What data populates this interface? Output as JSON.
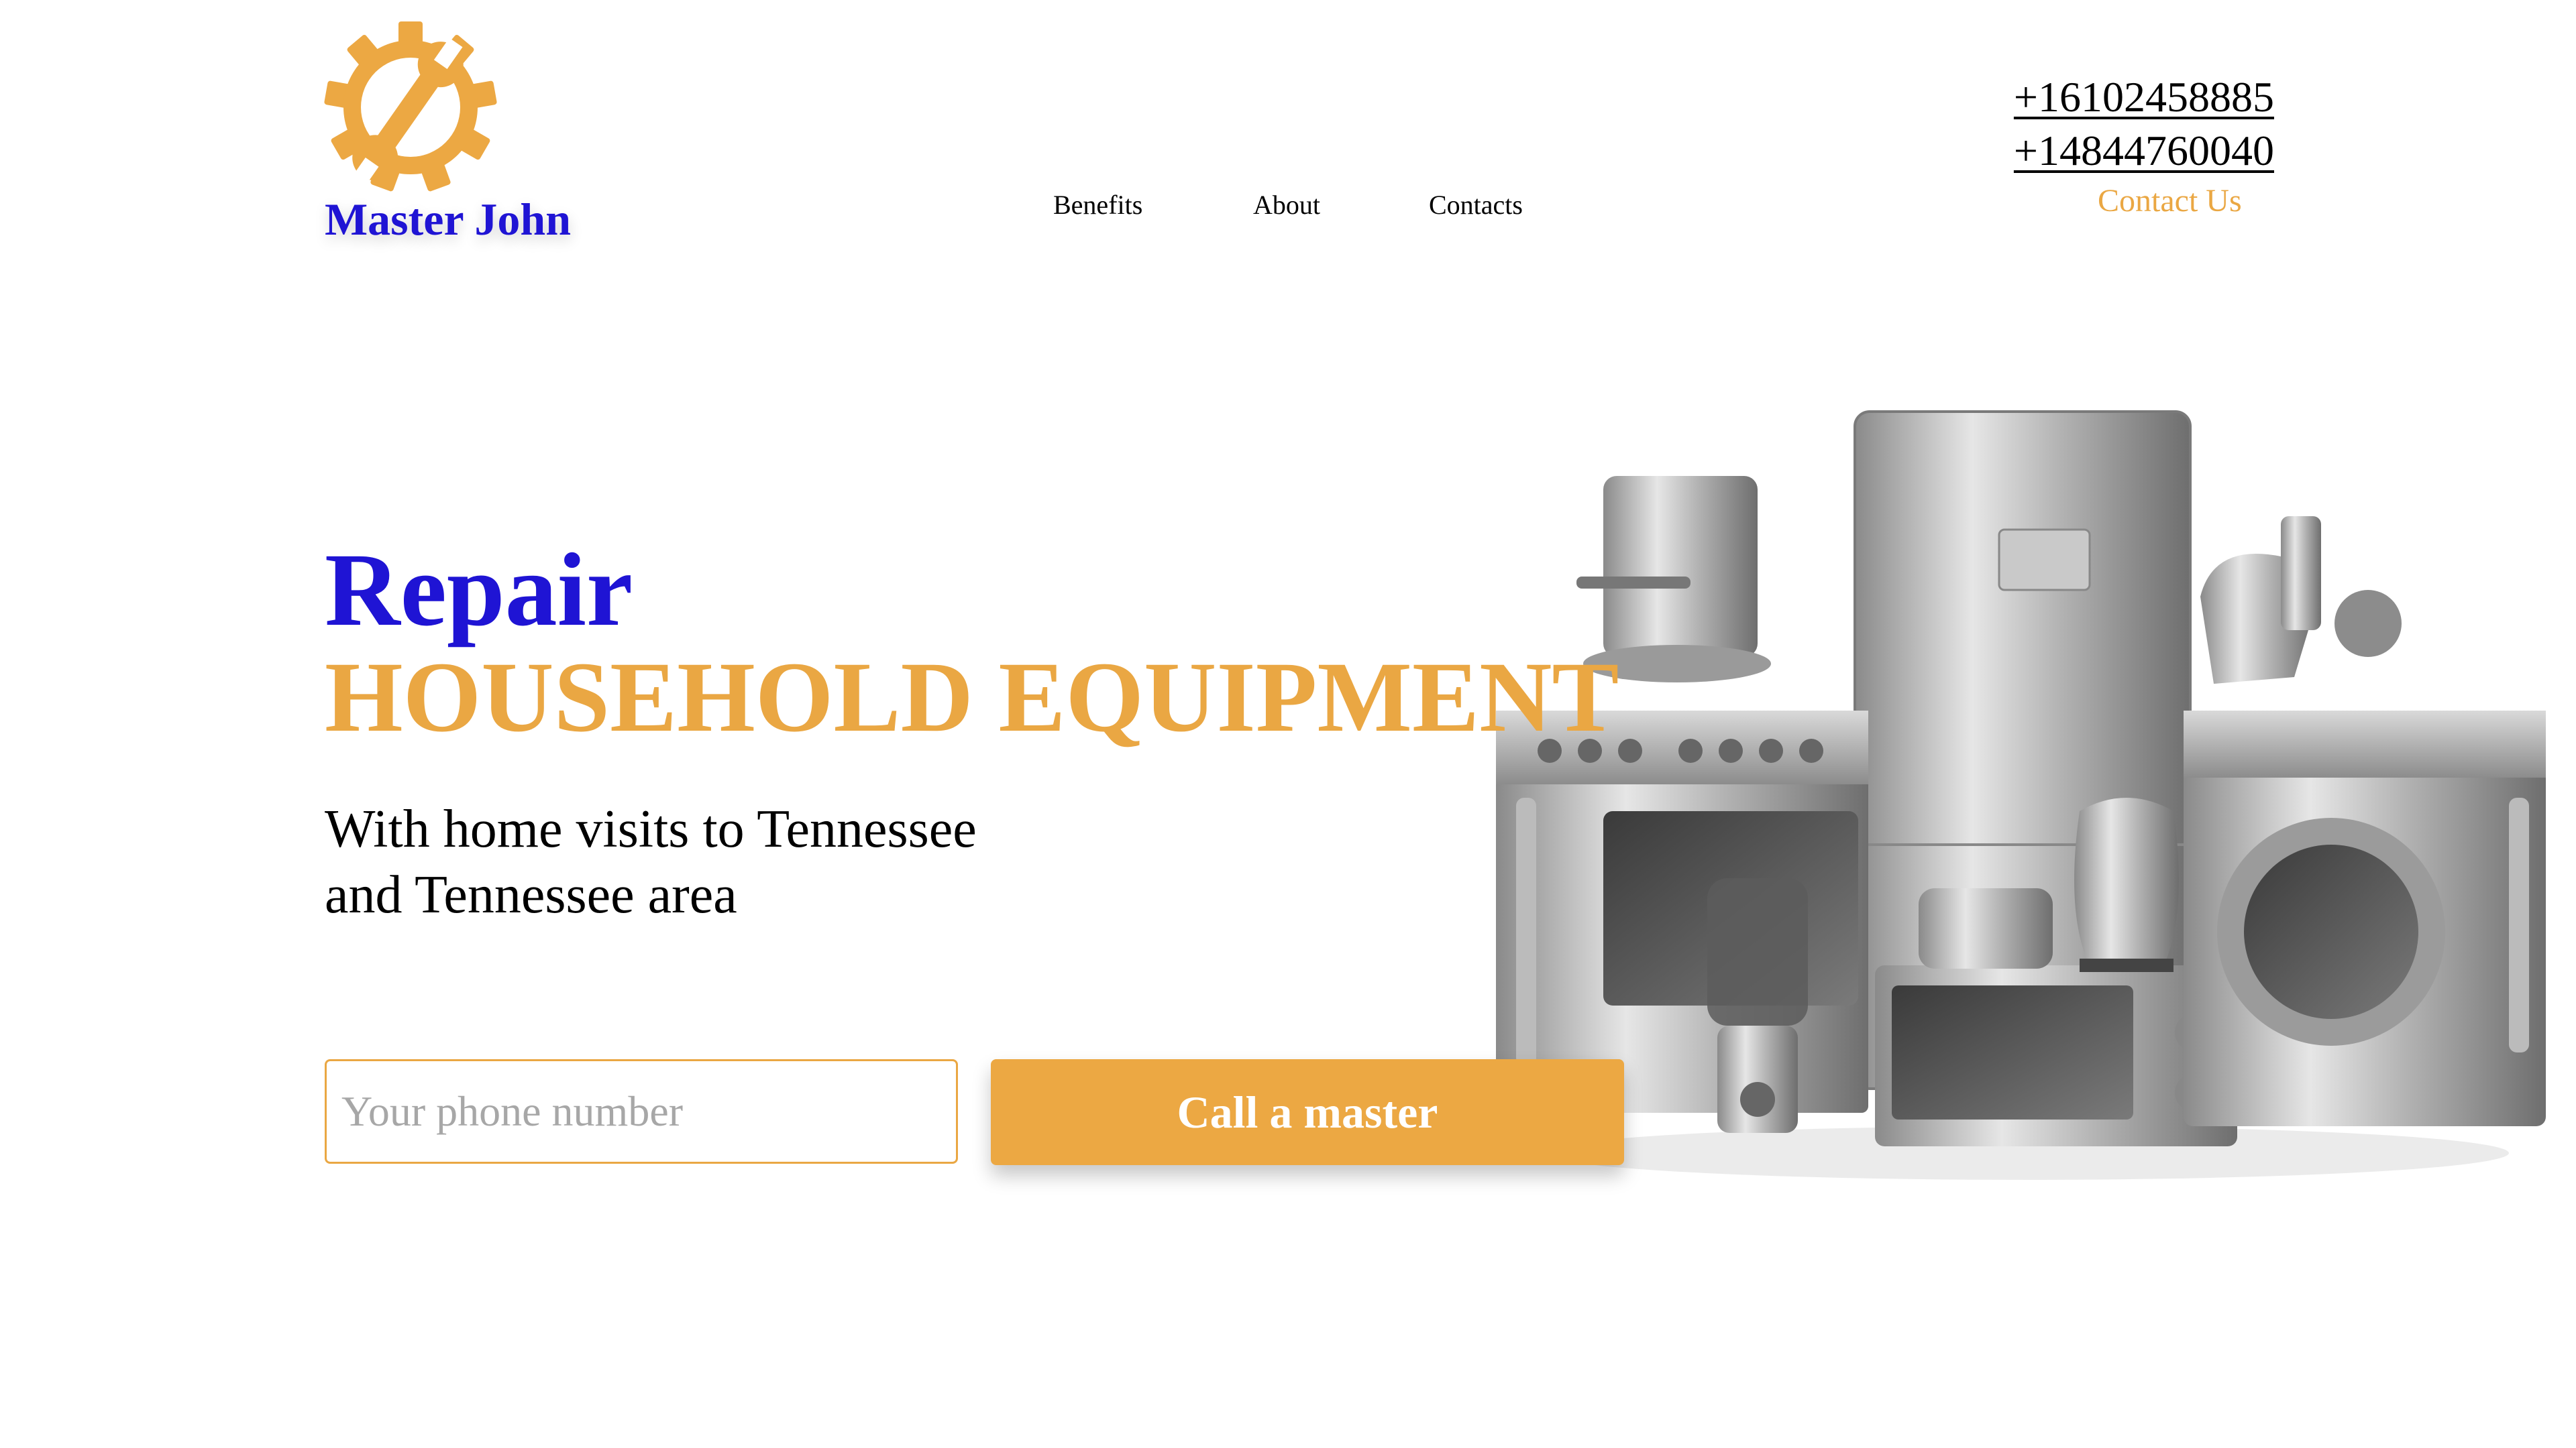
{
  "header": {
    "brand_name": "Master John",
    "logo_icon": "gear-wrench-icon",
    "nav": {
      "benefits": "Benefits",
      "about": "About",
      "contacts": "Contacts"
    },
    "phones": [
      "+16102458885",
      "+14844760040"
    ],
    "contact_us": "Contact Us"
  },
  "hero": {
    "title": "Repair",
    "subtitle": "HOUSEHOLD EQUIPMENT",
    "description_line1": "With home visits to Tennessee",
    "description_line2": "and Tennessee area",
    "phone_placeholder": "Your phone number",
    "phone_value": "",
    "call_button": "Call a master",
    "image": "household-appliances-image"
  },
  "colors": {
    "brand_blue": "#1f14d4",
    "accent_orange": "#eca843",
    "text_black": "#000000",
    "background": "#ffffff"
  }
}
